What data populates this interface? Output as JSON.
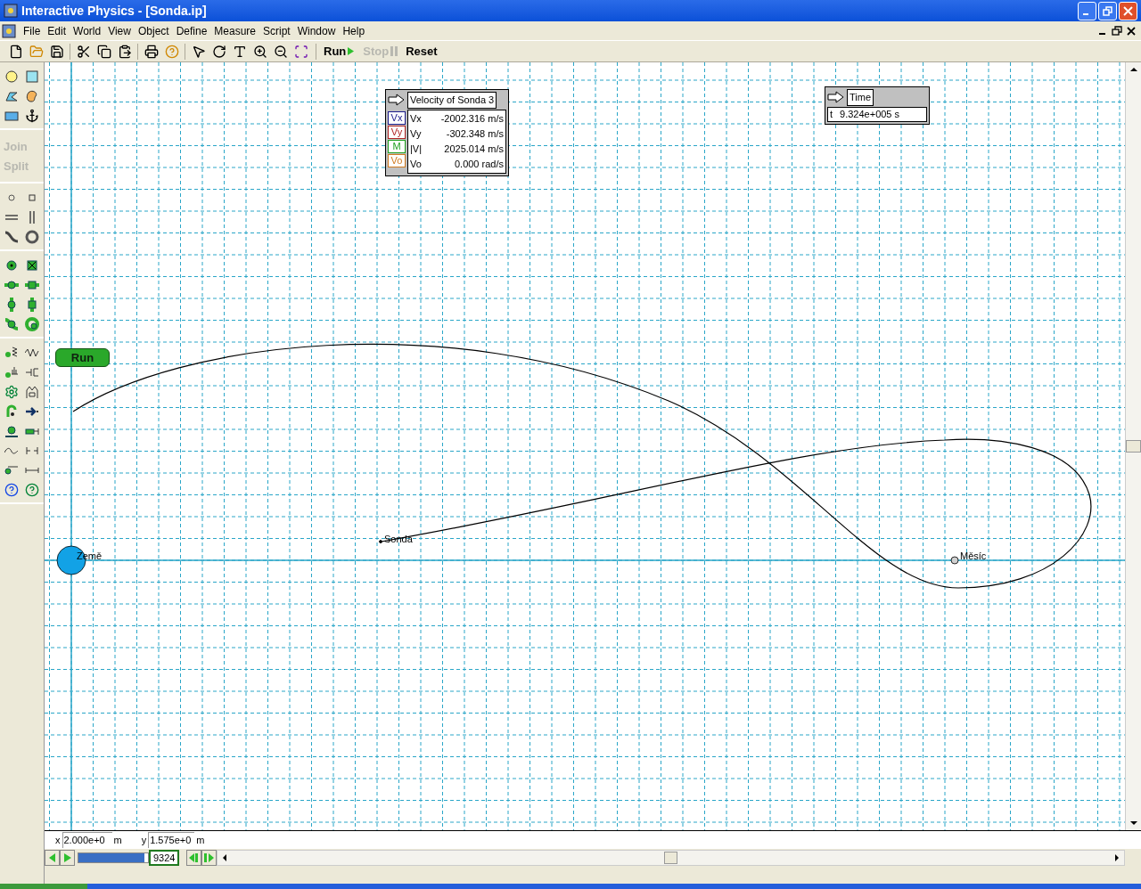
{
  "window": {
    "title": "Interactive Physics - [Sonda.ip]"
  },
  "menu": [
    "File",
    "Edit",
    "World",
    "View",
    "Object",
    "Define",
    "Measure",
    "Script",
    "Window",
    "Help"
  ],
  "toolbar": {
    "run": "Run",
    "stop": {
      "label": "Stop",
      "disabled": true
    },
    "reset": "Reset"
  },
  "palette": {
    "join": {
      "label": "Join",
      "disabled": true
    },
    "split": {
      "label": "Split",
      "disabled": true
    }
  },
  "velocity_meter": {
    "title": "Velocity of Sonda 3",
    "rows": [
      {
        "button": "Vx",
        "label": "Vx",
        "value": "-2002.316 m/s",
        "color": "#1c1c8c"
      },
      {
        "button": "Vy",
        "label": "Vy",
        "value": "-302.348 m/s",
        "color": "#b02424"
      },
      {
        "button": "M",
        "label": "|V|",
        "value": "2025.014 m/s",
        "color": "#20a020"
      },
      {
        "button": "Vo",
        "label": "Vo",
        "value": "0.000 rad/s",
        "color": "#d07a20"
      }
    ]
  },
  "time_meter": {
    "title": "Time",
    "label": "t",
    "value": "9.324e+005 s"
  },
  "canvas": {
    "run_button": "Run",
    "bodies": [
      {
        "kind": "planet",
        "label": "Země"
      },
      {
        "kind": "probe",
        "label": "Sonda"
      },
      {
        "kind": "moon",
        "label": "Měsíc"
      }
    ]
  },
  "coords": {
    "x_label": "x",
    "x_value": "2.000e+0",
    "x_unit": "m",
    "y_label": "y",
    "y_value": "1.575e+0",
    "y_unit": "m"
  },
  "playback": {
    "frame": "9324",
    "level": 0.95
  }
}
